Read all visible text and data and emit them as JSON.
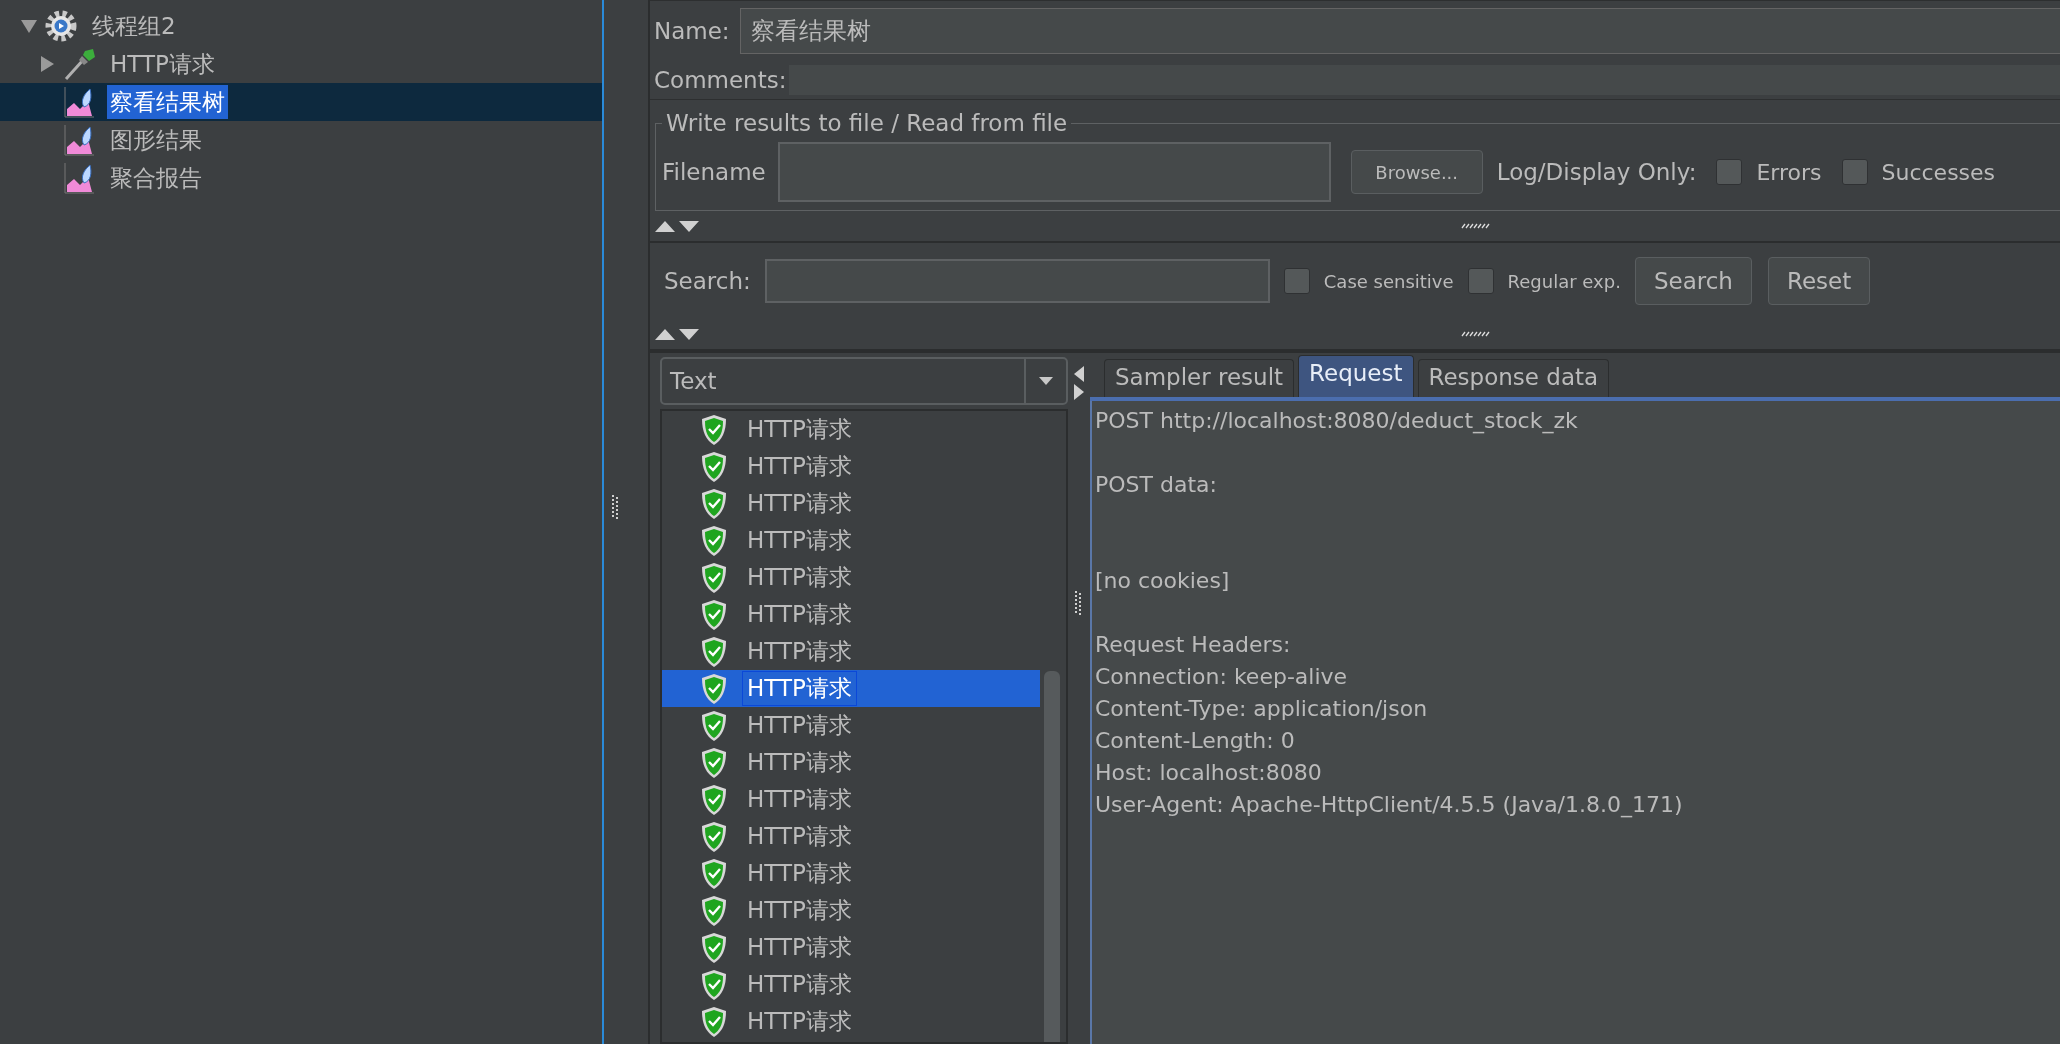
{
  "tree": [
    {
      "label": "线程组2",
      "kind": "thread_group",
      "expanded": true,
      "selected": false,
      "children": [
        {
          "label": "HTTP请求",
          "kind": "sampler",
          "expanded": false,
          "selected": false
        },
        {
          "label": "察看结果树",
          "kind": "listener",
          "selected": true
        },
        {
          "label": "图形结果",
          "kind": "listener",
          "selected": false
        },
        {
          "label": "聚合报告",
          "kind": "listener",
          "selected": false
        }
      ]
    }
  ],
  "name_field": {
    "label": "Name:",
    "value": "察看结果树"
  },
  "comments_field": {
    "label": "Comments:"
  },
  "file_group": {
    "title": "Write results to file / Read from file",
    "filename_label": "Filename",
    "browse_button": "Browse...",
    "log_label": "Log/Display Only:",
    "options": [
      {
        "label": "Errors",
        "checked": false
      },
      {
        "label": "Successes",
        "checked": false
      }
    ]
  },
  "search_bar": {
    "label": "Search:",
    "options": [
      {
        "label": "Case sensitive",
        "checked": false
      },
      {
        "label": "Regular exp.",
        "checked": false
      }
    ],
    "buttons": [
      "Search",
      "Reset"
    ]
  },
  "renderer_dropdown": {
    "value": "Text"
  },
  "results": [
    {
      "label": "HTTP请求",
      "selected": false
    },
    {
      "label": "HTTP请求",
      "selected": false
    },
    {
      "label": "HTTP请求",
      "selected": false
    },
    {
      "label": "HTTP请求",
      "selected": false
    },
    {
      "label": "HTTP请求",
      "selected": false
    },
    {
      "label": "HTTP请求",
      "selected": false
    },
    {
      "label": "HTTP请求",
      "selected": false
    },
    {
      "label": "HTTP请求",
      "selected": true
    },
    {
      "label": "HTTP请求",
      "selected": false
    },
    {
      "label": "HTTP请求",
      "selected": false
    },
    {
      "label": "HTTP请求",
      "selected": false
    },
    {
      "label": "HTTP请求",
      "selected": false
    },
    {
      "label": "HTTP请求",
      "selected": false
    },
    {
      "label": "HTTP请求",
      "selected": false
    },
    {
      "label": "HTTP请求",
      "selected": false
    },
    {
      "label": "HTTP请求",
      "selected": false
    },
    {
      "label": "HTTP请求",
      "selected": false
    }
  ],
  "tabs": [
    {
      "label": "Sampler result",
      "selected": false
    },
    {
      "label": "Request",
      "selected": true
    },
    {
      "label": "Response data",
      "selected": false
    }
  ],
  "request_text": "POST http://localhost:8080/deduct_stock_zk\n\nPOST data:\n\n\n[no cookies]\n\nRequest Headers:\nConnection: keep-alive\nContent-Type: application/json\nContent-Length: 0\nHost: localhost:8080\nUser-Agent: Apache-HttpClient/4.5.5 (Java/1.8.0_171)"
}
